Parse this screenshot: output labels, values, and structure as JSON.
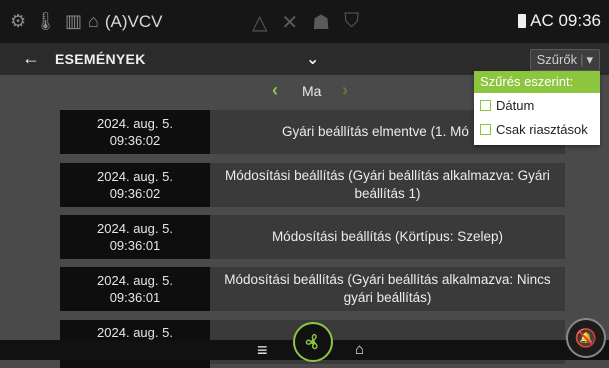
{
  "status_bar": {
    "unit_name": "(A)VCV",
    "power_label": "AC 09:36",
    "icons": [
      "fan-settings-icon",
      "thermometer-icon",
      "heater-icon",
      "house-icon",
      "warning-icon",
      "tools-icon",
      "person-icon",
      "filter-icon",
      "battery-icon"
    ]
  },
  "header": {
    "title": "ESEMÉNYEK",
    "filter_button": "Szűrők",
    "filter_button_caret": "▾"
  },
  "date_nav": {
    "label": "Ma"
  },
  "events": [
    {
      "date": "2024. aug. 5.",
      "time": "09:36:02",
      "desc": "Gyári beállítás elmentve (1. Mó"
    },
    {
      "date": "2024. aug. 5.",
      "time": "09:36:02",
      "desc": "Módosítási beállítás (Gyári beállítás alkalmazva: Gyári beállítás 1)"
    },
    {
      "date": "2024. aug. 5.",
      "time": "09:36:01",
      "desc": "Módosítási beállítás (Körtípus: Szelep)"
    },
    {
      "date": "2024. aug. 5.",
      "time": "09:36:01",
      "desc": "Módosítási beállítás (Gyári beállítás alkalmazva: Nincs gyári beállítás)"
    },
    {
      "date": "2024. aug. 5.",
      "time": "",
      "desc": ""
    }
  ],
  "filter_dropdown": {
    "heading": "Szűrés eszerint:",
    "options": [
      {
        "label": "Dátum",
        "checked": false
      },
      {
        "label": "Csak riasztások",
        "checked": false
      }
    ]
  },
  "colors": {
    "accent": "#8cc63f",
    "background": "#4a4a4a",
    "row_bg": "#3a3a3a",
    "time_bg": "#0e0e0e"
  }
}
